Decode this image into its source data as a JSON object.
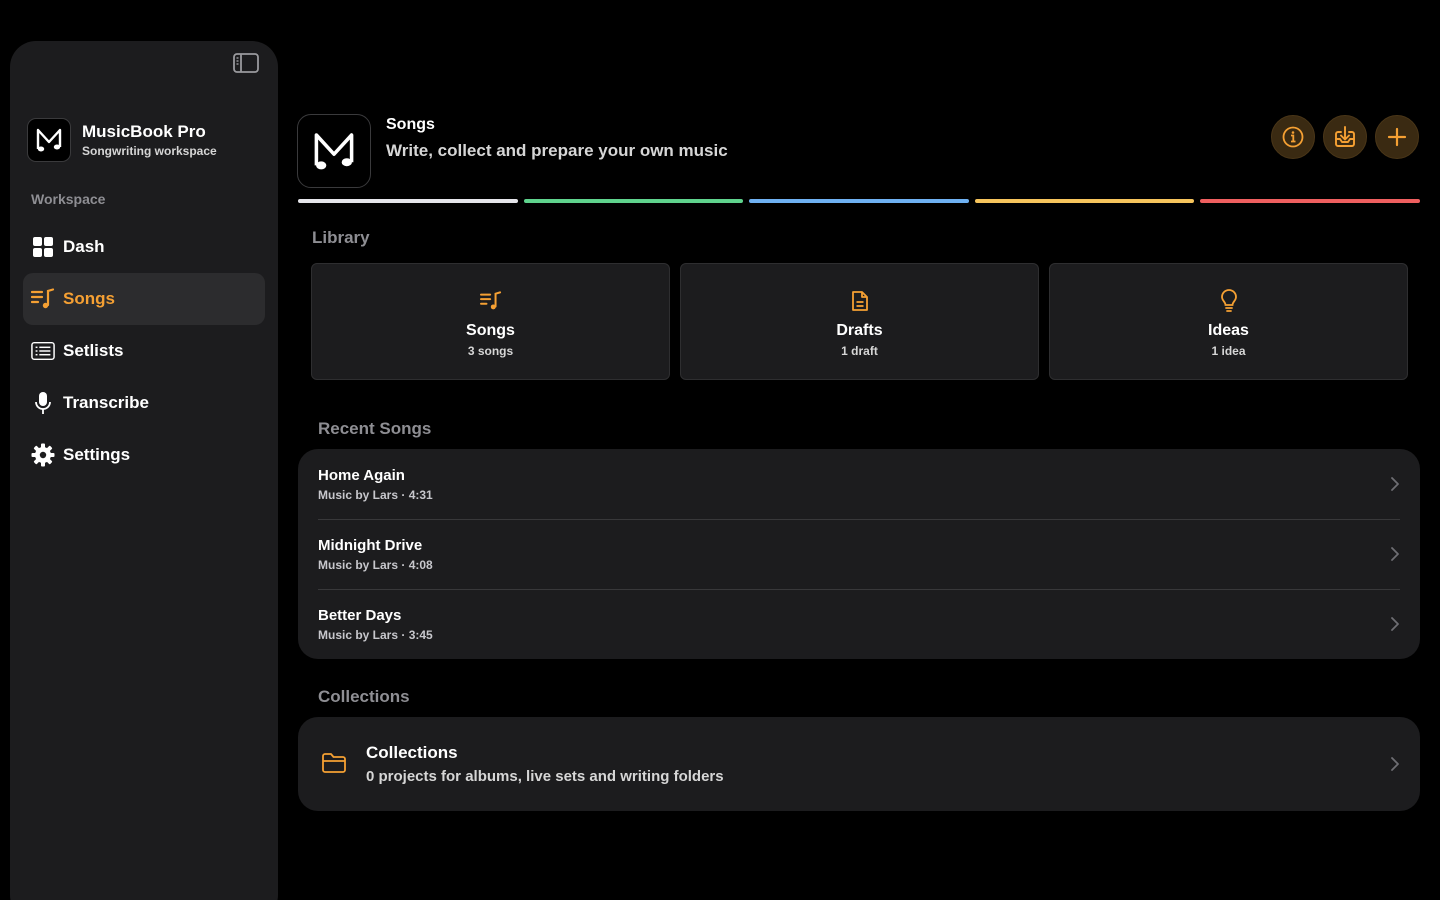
{
  "brand": {
    "name": "MusicBook Pro",
    "subtitle": "Songwriting workspace"
  },
  "sidebar": {
    "section_label": "Workspace",
    "items": [
      {
        "label": "Dash",
        "icon": "grid-icon",
        "active": false
      },
      {
        "label": "Songs",
        "icon": "music-list-icon",
        "active": true
      },
      {
        "label": "Setlists",
        "icon": "list-icon",
        "active": false
      },
      {
        "label": "Transcribe",
        "icon": "microphone-icon",
        "active": false
      },
      {
        "label": "Settings",
        "icon": "gear-icon",
        "active": false
      }
    ]
  },
  "header": {
    "title": "Songs",
    "subtitle": "Write, collect and prepare your own music",
    "actions": [
      "info-icon",
      "import-icon",
      "plus-icon"
    ]
  },
  "color_bars": [
    "#e5e5ea",
    "#5fd38d",
    "#6fb1f2",
    "#f6c45c",
    "#ef5f5f"
  ],
  "library": {
    "label": "Library",
    "cards": [
      {
        "title": "Songs",
        "count": "3 songs",
        "icon": "music-list-icon"
      },
      {
        "title": "Drafts",
        "count": "1 draft",
        "icon": "document-icon"
      },
      {
        "title": "Ideas",
        "count": "1 idea",
        "icon": "lightbulb-icon"
      }
    ]
  },
  "recent": {
    "label": "Recent Songs",
    "songs": [
      {
        "title": "Home Again",
        "meta": "Music by Lars · 4:31"
      },
      {
        "title": "Midnight Drive",
        "meta": "Music by Lars · 4:08"
      },
      {
        "title": "Better Days",
        "meta": "Music by Lars · 3:45"
      }
    ]
  },
  "collections": {
    "label": "Collections",
    "title": "Collections",
    "subtitle": "0 projects for albums, live sets and writing folders"
  },
  "colors": {
    "accent": "#f5a033",
    "background": "#000000",
    "panel": "#1c1c1e"
  }
}
